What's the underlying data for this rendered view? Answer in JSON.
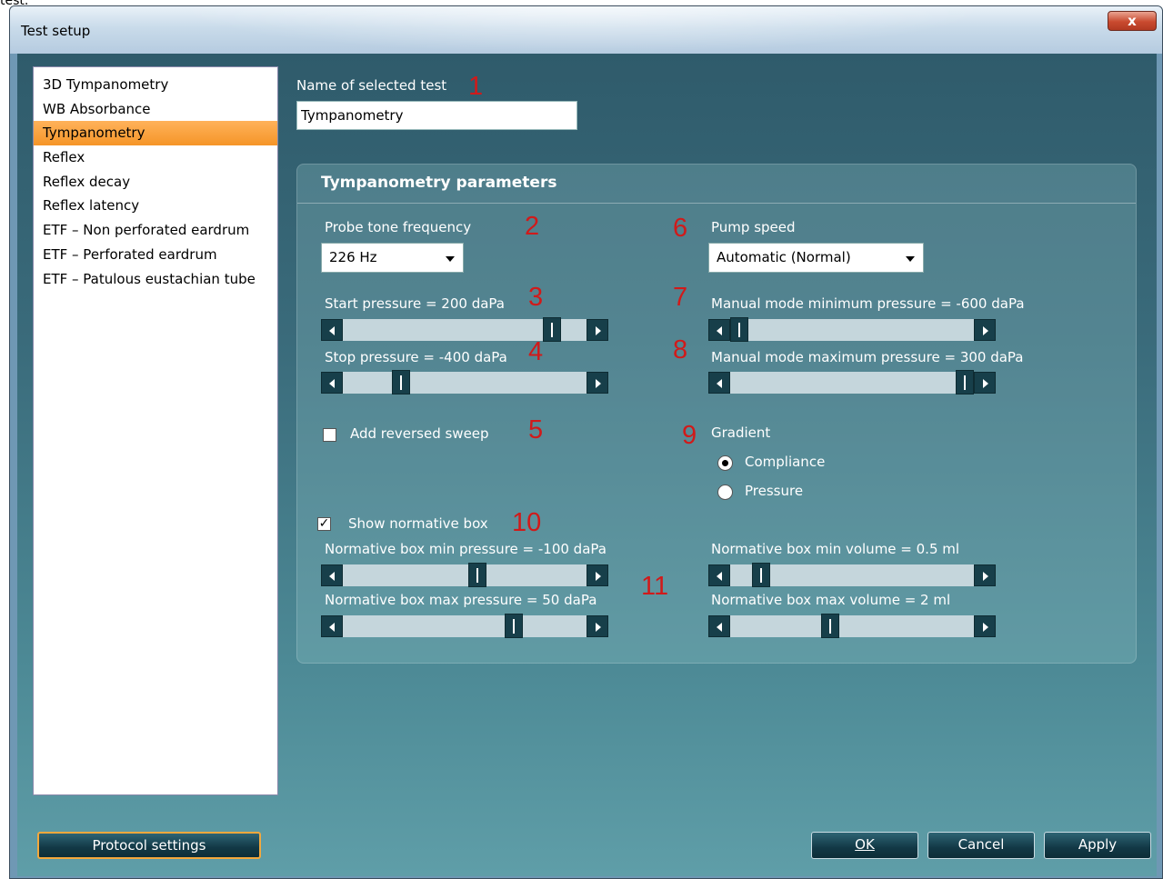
{
  "top_clip_text": "test.",
  "window": {
    "title": "Test setup",
    "close_label": "x"
  },
  "tests": [
    "3D Tympanometry",
    "WB Absorbance",
    "Tympanometry",
    "Reflex",
    "Reflex decay",
    "Reflex latency",
    "ETF – Non perforated eardrum",
    "ETF – Perforated eardrum",
    "ETF – Patulous eustachian tube"
  ],
  "selected_test": "Tympanometry",
  "name_field": {
    "label": "Name of selected test",
    "value": "Tympanometry"
  },
  "params": {
    "title": "Tympanometry parameters",
    "probe_tone": {
      "label": "Probe tone frequency",
      "value": "226 Hz"
    },
    "pump_speed": {
      "label": "Pump speed",
      "value": "Automatic (Normal)"
    },
    "start_pressure": {
      "label": "Start pressure = 200 daPa",
      "position": 0.86
    },
    "stop_pressure": {
      "label": "Stop pressure = -400 daPa",
      "position": 0.25
    },
    "manual_min": {
      "label": "Manual mode minimum pressure = -600 daPa",
      "position": 0.0
    },
    "manual_max": {
      "label": "Manual mode maximum pressure = 300 daPa",
      "position": 1.0
    },
    "reversed_sweep": {
      "label": "Add reversed sweep",
      "checked": false
    },
    "gradient": {
      "label": "Gradient",
      "options": [
        "Compliance",
        "Pressure"
      ],
      "selected": "Compliance"
    },
    "show_normative": {
      "label": "Show normative box",
      "checked": true,
      "check_glyph": "✓"
    },
    "norm_min_pressure": {
      "label": "Normative box min pressure = -100 daPa",
      "position": 0.6
    },
    "norm_max_pressure": {
      "label": "Normative box max pressure = 50 daPa",
      "position": 0.75
    },
    "norm_min_volume": {
      "label": "Normative box min volume = 0.5 ml",
      "position": 0.1
    },
    "norm_max_volume": {
      "label": "Normative box max volume = 2 ml",
      "position": 0.45
    }
  },
  "annotations": [
    "1",
    "2",
    "3",
    "4",
    "5",
    "6",
    "7",
    "8",
    "9",
    "10",
    "11"
  ],
  "buttons": {
    "protocol": "Protocol settings",
    "ok": "OK",
    "cancel": "Cancel",
    "apply": "Apply"
  },
  "colors": {
    "selection": "#f59528",
    "annotation": "#d11a1a",
    "panel": "#4d8a96"
  }
}
